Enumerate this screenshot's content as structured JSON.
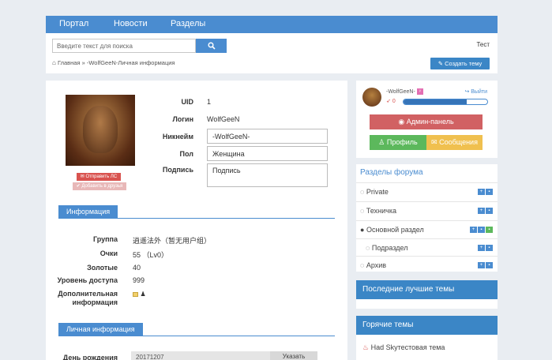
{
  "nav": {
    "items": [
      "Портал",
      "Новости",
      "Разделы"
    ]
  },
  "search": {
    "placeholder": "Введите текст для поиска"
  },
  "header": {
    "test_link": "Тест",
    "create_topic": "Создать тему"
  },
  "breadcrumb": {
    "home": "Главная",
    "sep": "»",
    "current": "-WolfGeeN-Личная информация"
  },
  "profile": {
    "pm_button": "Отправить ЛС",
    "friend_button": "Добавить в друзья",
    "fields": {
      "uid_label": "UID",
      "uid_value": "1",
      "login_label": "Логин",
      "login_value": "WolfGeeN",
      "nick_label": "Никнейм",
      "nick_value": "-WolfGeeN-",
      "gender_label": "Пол",
      "gender_value": "Женщина",
      "signature_label": "Подпись",
      "signature_value": "Подпись"
    }
  },
  "info": {
    "title": "Информация",
    "group_label": "Группа",
    "group_value": "逍遥法外（暂无用户组）",
    "points_label": "Очки",
    "points_value": "55 （Lv0）",
    "gold_label": "Золотые",
    "gold_value": "40",
    "access_label": "Уровень доступа",
    "access_value": "999",
    "extra_label": "Дополнительная информация"
  },
  "personal": {
    "title": "Личная информация",
    "birthday_label": "День рождения",
    "birthday_value": "20171207",
    "birthday_button": "Указать"
  },
  "sidebar": {
    "nickname": "-WolfGeeN-",
    "gender_icon": "♀",
    "logout": "Выйти",
    "reputation": "0",
    "progress_fraction": 0.75,
    "admin_button": "Админ-панель",
    "profile_button": "Профиль",
    "messages_button": "Сообщения",
    "forums_title": "Разделы форума",
    "forums": [
      "Private",
      "Техничка",
      "Основной раздел",
      "Подраздел",
      "Архив"
    ],
    "best_title": "Последние лучшие темы",
    "hot_title": "Горячие темы",
    "hot_items": [
      "Had Skyтестовая тема"
    ]
  },
  "colors": {
    "accent": "#4a8cd0",
    "danger": "#d16163",
    "success": "#5cb85c",
    "warning": "#f0c04f"
  }
}
